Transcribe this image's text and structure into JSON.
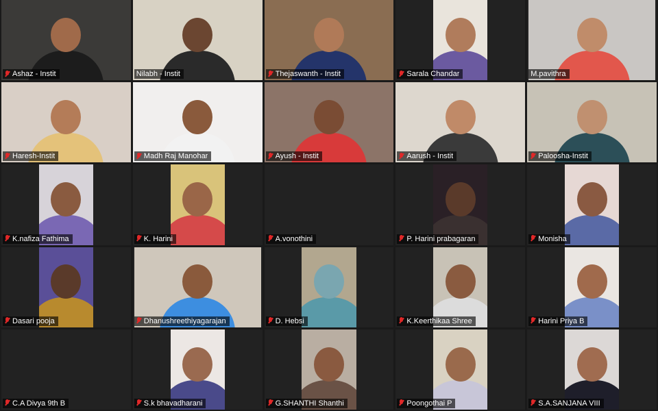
{
  "meeting": {
    "layout": "gallery-view-5x5",
    "muted_icon": "muted-mic-icon",
    "participants": [
      {
        "name": "Ashaz - Instit",
        "bg": "#3b3a38",
        "skin": "#a06a4a",
        "shirt": "#1c1c1c",
        "video": "full",
        "muted": true
      },
      {
        "name": "Nilabh - Instit",
        "bg": "#d8d2c4",
        "skin": "#6b4631",
        "shirt": "#2a2a2a",
        "video": "full",
        "muted": false,
        "active": true
      },
      {
        "name": "Thejaswanth - Instit",
        "bg": "#8a6d52",
        "skin": "#b07a58",
        "shirt": "#24346a",
        "video": "full",
        "muted": true
      },
      {
        "name": "Sarala Chandar",
        "bg": "#e9e4dc",
        "skin": "#b07c5c",
        "shirt": "#6b5aa0",
        "video": "portrait",
        "muted": true
      },
      {
        "name": "M.pavithra",
        "bg": "#c9c6c3",
        "skin": "#c08c6a",
        "shirt": "#e2574c",
        "video": "landscape",
        "muted": false
      },
      {
        "name": "Haresh-Instit",
        "bg": "#d9cfc6",
        "skin": "#b47c58",
        "shirt": "#e4c27a",
        "video": "full",
        "muted": true
      },
      {
        "name": "Madh Raj Manohar",
        "bg": "#f1efee",
        "skin": "#8a5a3c",
        "shirt": "#f2f2f2",
        "video": "full",
        "muted": true
      },
      {
        "name": "Ayush - Instit",
        "bg": "#8c7468",
        "skin": "#7a4c34",
        "shirt": "#d83a3a",
        "video": "full",
        "muted": true
      },
      {
        "name": "Aarush - Instit",
        "bg": "#ddd7ce",
        "skin": "#c08a68",
        "shirt": "#3a3a3a",
        "video": "full",
        "muted": true
      },
      {
        "name": "Paloosha-Instit",
        "bg": "#c7c2b6",
        "skin": "#c09070",
        "shirt": "#2c4f58",
        "video": "full",
        "muted": true
      },
      {
        "name": "K.nafiza Fathima",
        "bg": "#d7d3d9",
        "skin": "#8a5b40",
        "shirt": "#7a68b4",
        "video": "portrait",
        "muted": true
      },
      {
        "name": "K. Harini",
        "bg": "#d9c37a",
        "skin": "#9a6648",
        "shirt": "#d54a4a",
        "video": "portrait",
        "muted": true
      },
      {
        "name": "A.vonothini",
        "bg": "#222222",
        "skin": "",
        "shirt": "",
        "video": "none",
        "muted": true
      },
      {
        "name": "P. Harini prabagaran",
        "bg": "#2a2026",
        "skin": "#5a3a2a",
        "shirt": "#3a3030",
        "video": "portrait",
        "muted": true
      },
      {
        "name": "Monisha",
        "bg": "#e6d8d4",
        "skin": "#8a5a42",
        "shirt": "#5a6aa6",
        "video": "portrait",
        "muted": true
      },
      {
        "name": "Dasari pooja",
        "bg": "#5a4f98",
        "skin": "#5a3a2a",
        "shirt": "#b88a2e",
        "video": "portrait",
        "muted": true
      },
      {
        "name": "Dhanushreethiyagarajan",
        "bg": "#cfc7bb",
        "skin": "#8a5a3c",
        "shirt": "#3d8ee0",
        "video": "landscape",
        "muted": true
      },
      {
        "name": "D. Hebsi",
        "bg": "#b2a78f",
        "skin": "#7aa6b0",
        "shirt": "#5a9aa8",
        "video": "portrait",
        "muted": true
      },
      {
        "name": "K.Keerthikaa Shree",
        "bg": "#c8c2b6",
        "skin": "#8a5b40",
        "shirt": "#dcdcdc",
        "video": "portrait",
        "muted": true
      },
      {
        "name": "Harini Priya B",
        "bg": "#eae6e2",
        "skin": "#a06a4c",
        "shirt": "#7a90c8",
        "video": "portrait",
        "muted": true
      },
      {
        "name": "C.A Divya 9th B",
        "bg": "#222222",
        "skin": "",
        "shirt": "",
        "video": "none",
        "muted": true
      },
      {
        "name": "S.k bhavadharani",
        "bg": "#ece7e4",
        "skin": "#9a6a50",
        "shirt": "#4a4a8a",
        "video": "portrait",
        "muted": true
      },
      {
        "name": "G.SHANTHI Shanthi",
        "bg": "#b9aea2",
        "skin": "#8a5a40",
        "shirt": "#6a5246",
        "video": "portrait",
        "muted": true
      },
      {
        "name": "Poongothai P",
        "bg": "#d9d2c2",
        "skin": "#9a6a4c",
        "shirt": "#c8c6d8",
        "video": "portrait",
        "muted": true
      },
      {
        "name": "S.A.SANJANA VIII",
        "bg": "#dcd8d6",
        "skin": "#a06c50",
        "shirt": "#1e1e2a",
        "video": "portrait",
        "muted": true
      }
    ]
  }
}
